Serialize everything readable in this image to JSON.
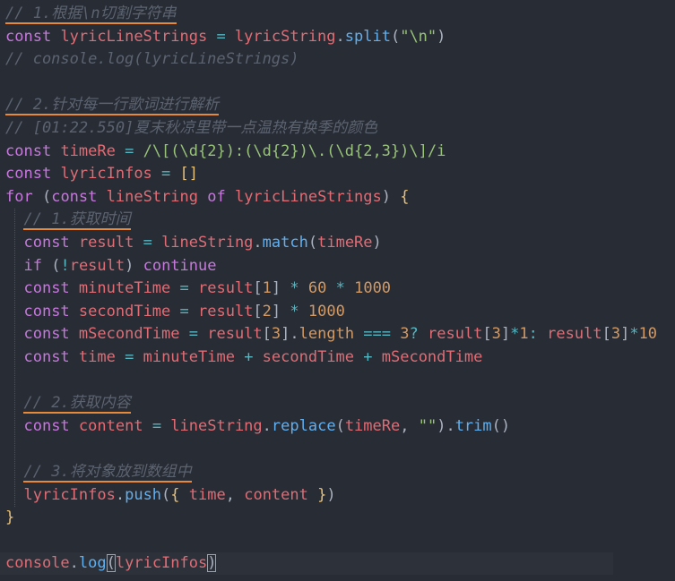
{
  "lines": [
    {
      "tokens": [
        {
          "text": "// 1.根据\\n切割字符串",
          "cls": "cm u"
        }
      ]
    },
    {
      "tokens": [
        {
          "text": "const",
          "cls": "kw"
        },
        {
          "text": " ",
          "cls": "pun"
        },
        {
          "text": "lyricLineStrings",
          "cls": "var"
        },
        {
          "text": " = ",
          "cls": "op"
        },
        {
          "text": "lyricString",
          "cls": "var"
        },
        {
          "text": ".",
          "cls": "pun"
        },
        {
          "text": "split",
          "cls": "fn"
        },
        {
          "text": "(",
          "cls": "pun"
        },
        {
          "text": "\"\\n\"",
          "cls": "str"
        },
        {
          "text": ")",
          "cls": "pun"
        }
      ]
    },
    {
      "tokens": [
        {
          "text": "// console.log(lyricLineStrings)",
          "cls": "cm"
        }
      ]
    },
    {
      "tokens": []
    },
    {
      "tokens": [
        {
          "text": "// 2.针对每一行歌词进行解析",
          "cls": "cm u"
        }
      ]
    },
    {
      "tokens": [
        {
          "text": "// [01:22.550]夏末秋凉里带一点温热有换季的颜色",
          "cls": "cm"
        }
      ]
    },
    {
      "tokens": [
        {
          "text": "const",
          "cls": "kw"
        },
        {
          "text": " ",
          "cls": "pun"
        },
        {
          "text": "timeRe",
          "cls": "var"
        },
        {
          "text": " = ",
          "cls": "op"
        },
        {
          "text": "/\\[(\\d{2}):(\\d{2})\\.(\\d{2,3})\\]/i",
          "cls": "rgx"
        }
      ]
    },
    {
      "tokens": [
        {
          "text": "const",
          "cls": "kw"
        },
        {
          "text": " ",
          "cls": "pun"
        },
        {
          "text": "lyricInfos",
          "cls": "var"
        },
        {
          "text": " = ",
          "cls": "op"
        },
        {
          "text": "[]",
          "cls": "brk"
        }
      ]
    },
    {
      "tokens": [
        {
          "text": "for",
          "cls": "kw"
        },
        {
          "text": " (",
          "cls": "pun"
        },
        {
          "text": "const",
          "cls": "kw"
        },
        {
          "text": " ",
          "cls": "pun"
        },
        {
          "text": "lineString",
          "cls": "var"
        },
        {
          "text": " of ",
          "cls": "kw"
        },
        {
          "text": "lyricLineStrings",
          "cls": "var"
        },
        {
          "text": ") ",
          "cls": "pun"
        },
        {
          "text": "{",
          "cls": "brk"
        }
      ]
    },
    {
      "tokens": [
        {
          "text": "  ",
          "cls": "pun"
        },
        {
          "text": "// 1.获取时间",
          "cls": "cm u"
        }
      ]
    },
    {
      "tokens": [
        {
          "text": "  ",
          "cls": "pun"
        },
        {
          "text": "const",
          "cls": "kw"
        },
        {
          "text": " ",
          "cls": "pun"
        },
        {
          "text": "result",
          "cls": "var"
        },
        {
          "text": " = ",
          "cls": "op"
        },
        {
          "text": "lineString",
          "cls": "var"
        },
        {
          "text": ".",
          "cls": "pun"
        },
        {
          "text": "match",
          "cls": "fn"
        },
        {
          "text": "(",
          "cls": "pun"
        },
        {
          "text": "timeRe",
          "cls": "var"
        },
        {
          "text": ")",
          "cls": "pun"
        }
      ]
    },
    {
      "tokens": [
        {
          "text": "  ",
          "cls": "pun"
        },
        {
          "text": "if",
          "cls": "kw"
        },
        {
          "text": " (",
          "cls": "pun"
        },
        {
          "text": "!",
          "cls": "op"
        },
        {
          "text": "result",
          "cls": "var"
        },
        {
          "text": ") ",
          "cls": "pun"
        },
        {
          "text": "continue",
          "cls": "kw"
        }
      ]
    },
    {
      "tokens": [
        {
          "text": "  ",
          "cls": "pun"
        },
        {
          "text": "const",
          "cls": "kw"
        },
        {
          "text": " ",
          "cls": "pun"
        },
        {
          "text": "minuteTime",
          "cls": "var"
        },
        {
          "text": " = ",
          "cls": "op"
        },
        {
          "text": "result",
          "cls": "var"
        },
        {
          "text": "[",
          "cls": "pun"
        },
        {
          "text": "1",
          "cls": "num"
        },
        {
          "text": "]",
          "cls": "pun"
        },
        {
          "text": " * ",
          "cls": "op"
        },
        {
          "text": "60",
          "cls": "num"
        },
        {
          "text": " * ",
          "cls": "op"
        },
        {
          "text": "1000",
          "cls": "num"
        }
      ]
    },
    {
      "tokens": [
        {
          "text": "  ",
          "cls": "pun"
        },
        {
          "text": "const",
          "cls": "kw"
        },
        {
          "text": " ",
          "cls": "pun"
        },
        {
          "text": "secondTime",
          "cls": "var"
        },
        {
          "text": " = ",
          "cls": "op"
        },
        {
          "text": "result",
          "cls": "var"
        },
        {
          "text": "[",
          "cls": "pun"
        },
        {
          "text": "2",
          "cls": "num"
        },
        {
          "text": "]",
          "cls": "pun"
        },
        {
          "text": " * ",
          "cls": "op"
        },
        {
          "text": "1000",
          "cls": "num"
        }
      ]
    },
    {
      "tokens": [
        {
          "text": "  ",
          "cls": "pun"
        },
        {
          "text": "const",
          "cls": "kw"
        },
        {
          "text": " ",
          "cls": "pun"
        },
        {
          "text": "mSecondTime",
          "cls": "var"
        },
        {
          "text": " = ",
          "cls": "op"
        },
        {
          "text": "result",
          "cls": "var"
        },
        {
          "text": "[",
          "cls": "pun"
        },
        {
          "text": "3",
          "cls": "num"
        },
        {
          "text": "].",
          "cls": "pun"
        },
        {
          "text": "length",
          "cls": "num"
        },
        {
          "text": " === ",
          "cls": "op"
        },
        {
          "text": "3",
          "cls": "num"
        },
        {
          "text": "? ",
          "cls": "op"
        },
        {
          "text": "result",
          "cls": "var"
        },
        {
          "text": "[",
          "cls": "pun"
        },
        {
          "text": "3",
          "cls": "num"
        },
        {
          "text": "]",
          "cls": "pun"
        },
        {
          "text": "*",
          "cls": "op"
        },
        {
          "text": "1",
          "cls": "num"
        },
        {
          "text": ": ",
          "cls": "op"
        },
        {
          "text": "result",
          "cls": "var"
        },
        {
          "text": "[",
          "cls": "pun"
        },
        {
          "text": "3",
          "cls": "num"
        },
        {
          "text": "]",
          "cls": "pun"
        },
        {
          "text": "*",
          "cls": "op"
        },
        {
          "text": "10",
          "cls": "num"
        }
      ]
    },
    {
      "tokens": [
        {
          "text": "  ",
          "cls": "pun"
        },
        {
          "text": "const",
          "cls": "kw"
        },
        {
          "text": " ",
          "cls": "pun"
        },
        {
          "text": "time",
          "cls": "var"
        },
        {
          "text": " = ",
          "cls": "op"
        },
        {
          "text": "minuteTime",
          "cls": "var"
        },
        {
          "text": " + ",
          "cls": "op"
        },
        {
          "text": "secondTime",
          "cls": "var"
        },
        {
          "text": " + ",
          "cls": "op"
        },
        {
          "text": "mSecondTime",
          "cls": "var"
        }
      ]
    },
    {
      "tokens": []
    },
    {
      "tokens": [
        {
          "text": "  ",
          "cls": "pun"
        },
        {
          "text": "// 2.获取内容",
          "cls": "cm u"
        }
      ]
    },
    {
      "tokens": [
        {
          "text": "  ",
          "cls": "pun"
        },
        {
          "text": "const",
          "cls": "kw"
        },
        {
          "text": " ",
          "cls": "pun"
        },
        {
          "text": "content",
          "cls": "var"
        },
        {
          "text": " = ",
          "cls": "op"
        },
        {
          "text": "lineString",
          "cls": "var"
        },
        {
          "text": ".",
          "cls": "pun"
        },
        {
          "text": "replace",
          "cls": "fn"
        },
        {
          "text": "(",
          "cls": "pun"
        },
        {
          "text": "timeRe",
          "cls": "var"
        },
        {
          "text": ", ",
          "cls": "pun"
        },
        {
          "text": "\"\"",
          "cls": "str"
        },
        {
          "text": ").",
          "cls": "pun"
        },
        {
          "text": "trim",
          "cls": "fn"
        },
        {
          "text": "()",
          "cls": "pun"
        }
      ]
    },
    {
      "tokens": []
    },
    {
      "tokens": [
        {
          "text": "  ",
          "cls": "pun"
        },
        {
          "text": "// 3.将对象放到数组中",
          "cls": "cm u"
        }
      ]
    },
    {
      "tokens": [
        {
          "text": "  ",
          "cls": "pun"
        },
        {
          "text": "lyricInfos",
          "cls": "var"
        },
        {
          "text": ".",
          "cls": "pun"
        },
        {
          "text": "push",
          "cls": "fn"
        },
        {
          "text": "(",
          "cls": "pun"
        },
        {
          "text": "{ ",
          "cls": "brk"
        },
        {
          "text": "time",
          "cls": "var"
        },
        {
          "text": ", ",
          "cls": "pun"
        },
        {
          "text": "content",
          "cls": "var"
        },
        {
          "text": " }",
          "cls": "brk"
        },
        {
          "text": ")",
          "cls": "pun"
        }
      ]
    },
    {
      "tokens": [
        {
          "text": "}",
          "cls": "brk"
        }
      ]
    },
    {
      "tokens": []
    },
    {
      "tokens": [
        {
          "text": "console",
          "cls": "var"
        },
        {
          "text": ".",
          "cls": "pun"
        },
        {
          "text": "log",
          "cls": "fn"
        },
        {
          "text": "(",
          "cls": "pun bracket-box"
        },
        {
          "text": "lyricInfos",
          "cls": "var"
        },
        {
          "text": ")",
          "cls": "pun bracket-box"
        }
      ]
    }
  ]
}
